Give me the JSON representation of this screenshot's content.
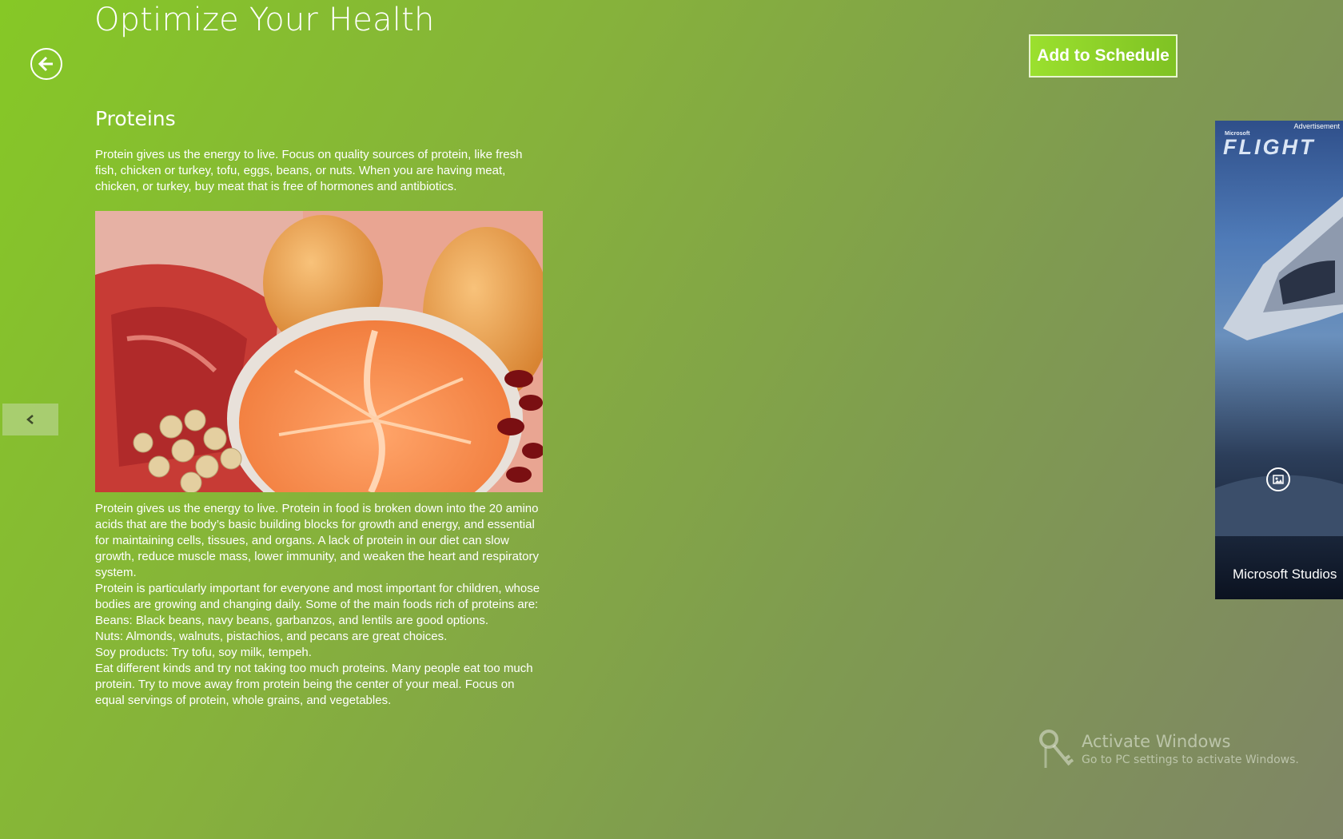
{
  "header": {
    "title": "Optimize Your Health",
    "add_button": "Add to Schedule"
  },
  "section": {
    "title": "Proteins",
    "intro": "Protein gives us the energy to live. Focus on quality sources of protein, like fresh fish, chicken or turkey, tofu, eggs, beans, or nuts. When you are having meat, chicken, or turkey, buy meat that is free of hormones and antibiotics.",
    "body": [
      "Protein gives us the energy to live. Protein in food is broken down into the 20 amino acids that are the body’s basic building blocks for growth and energy, and essential for maintaining cells, tissues, and organs. A lack of protein in our diet can slow growth, reduce muscle mass, lower immunity, and weaken the heart and respiratory system.",
      "Protein is particularly important for everyone and most important for children, whose bodies are growing and changing daily. Some of the main foods rich of proteins are:",
      "Beans:  Black beans, navy beans, garbanzos, and lentils are good options.",
      "Nuts: Almonds, walnuts, pistachios, and pecans are great choices.",
      "Soy products: Try tofu, soy milk, tempeh.",
      "Eat different kinds and try not taking too much proteins. Many people eat too much protein. Try to move away from protein being the center of your meal. Focus on equal servings of protein, whole grains, and vegetables."
    ]
  },
  "ad": {
    "label": "Advertisement",
    "brand_small": "Microsoft",
    "product": "FLIGHT",
    "studio": "Microsoft Studios"
  },
  "watermark": {
    "title": "Activate Windows",
    "subtitle": "Go to PC settings to activate Windows."
  },
  "icons": {
    "back": "back-arrow-icon",
    "nav_previous": "chevron-left-icon",
    "ad_info": "ad-info-icon",
    "watermark": "key-icon"
  },
  "colors": {
    "background_start": "#86c826",
    "background_end": "#7f8566",
    "button": "#8fd12a"
  }
}
